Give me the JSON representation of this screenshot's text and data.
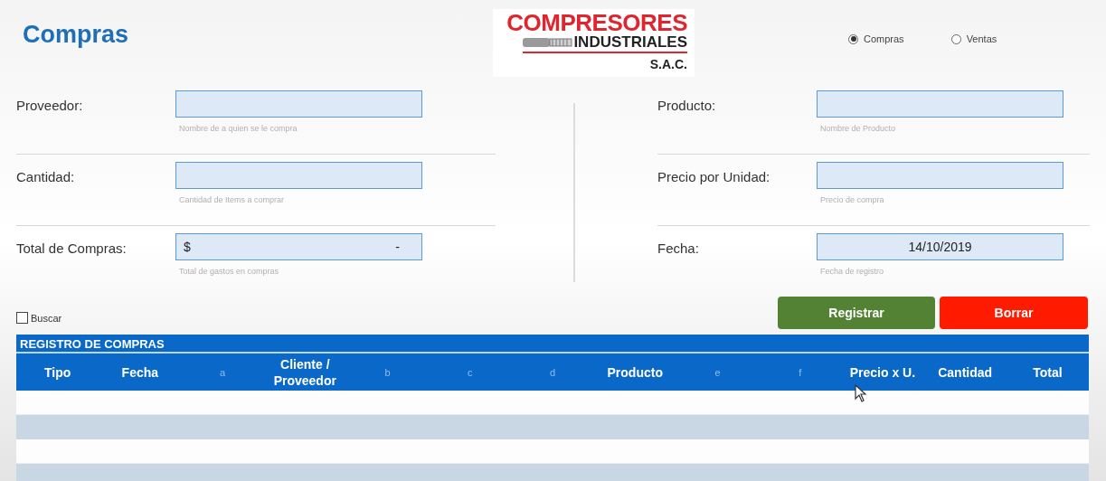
{
  "title": "Compras",
  "logo": {
    "line_1": "COMPRESORES",
    "line_2": "INDUSTRIALES",
    "line_3": "S.A.C."
  },
  "mode_options": [
    {
      "label": "Compras",
      "selected": true
    },
    {
      "label": "Ventas",
      "selected": false
    }
  ],
  "left_fields": [
    {
      "label": "Proveedor:",
      "hint": "Nombre de a quien se le compra"
    },
    {
      "label": "Cantidad:",
      "hint": "Cantidad de Items a comprar"
    },
    {
      "label": "Total de Compras:",
      "prefix": "$",
      "suffix": "-",
      "hint": "Total de gastos en compras"
    }
  ],
  "right_fields": [
    {
      "label": "Producto:",
      "hint": "Nombre de Producto"
    },
    {
      "label": "Precio por Unidad:",
      "hint": "Precio de compra"
    },
    {
      "label": "Fecha:",
      "value": "14/10/2019",
      "hint": "Fecha de registro"
    }
  ],
  "search_checkbox": {
    "label": "Buscar",
    "checked": false
  },
  "buttons": [
    {
      "label": "Registrar",
      "kind": "primary"
    },
    {
      "label": "Borrar",
      "kind": "danger"
    }
  ],
  "table": {
    "title": "REGISTRO DE COMPRAS",
    "columns": [
      {
        "label": "Tipo",
        "kind": "normal"
      },
      {
        "label": "Fecha",
        "kind": "normal"
      },
      {
        "label": "a",
        "kind": "faint"
      },
      {
        "label": "Cliente / Proveedor",
        "kind": "normal"
      },
      {
        "label": "b",
        "kind": "faint"
      },
      {
        "label": "c",
        "kind": "faint"
      },
      {
        "label": "d",
        "kind": "faint"
      },
      {
        "label": "Producto",
        "kind": "normal"
      },
      {
        "label": "e",
        "kind": "faint"
      },
      {
        "label": "f",
        "kind": "faint"
      },
      {
        "label": "Precio x U.",
        "kind": "normal"
      },
      {
        "label": "Cantidad",
        "kind": "normal"
      },
      {
        "label": "Total",
        "kind": "normal"
      }
    ],
    "rows": [
      {
        "shaded": false
      },
      {
        "shaded": true
      },
      {
        "shaded": false
      },
      {
        "shaded": true
      }
    ]
  }
}
